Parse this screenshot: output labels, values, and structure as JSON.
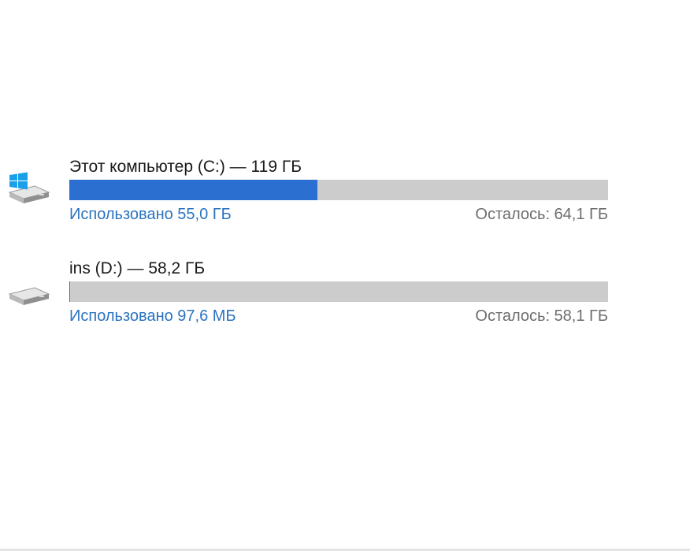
{
  "drives": [
    {
      "title": "Этот компьютер (C:) — 119 ГБ",
      "used_label": "Использовано 55,0 ГБ",
      "free_label": "Осталось: 64,1 ГБ",
      "used_fraction": 0.46,
      "icon": "windows-drive-icon"
    },
    {
      "title": "ins (D:) — 58,2 ГБ",
      "used_label": "Использовано 97,6 МБ",
      "free_label": "Осталось: 58,1 ГБ",
      "used_fraction": 0.0016,
      "icon": "drive-icon"
    }
  ],
  "colors": {
    "bar_fill": "#2b6fd0",
    "bar_track": "#cccccc",
    "used_text": "#2b73c0",
    "free_text": "#6d6d6d",
    "windows_logo": "#1aa0e8"
  }
}
